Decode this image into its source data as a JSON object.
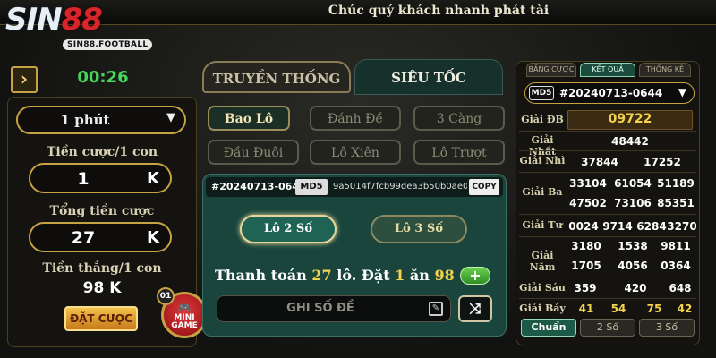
{
  "header": {
    "title": "Chúc quý khách nhanh phát tài"
  },
  "logo": {
    "part1": "SIN",
    "part2": "88",
    "sub": "SIN88.FOOTBALL"
  },
  "left": {
    "back_icon": "chevron-right-icon",
    "timer": "00:26",
    "duration": "1 phút",
    "bet_per_label": "Tiền cược/1 con",
    "bet_per_value": "1",
    "bet_unit": "K",
    "total_label": "Tổng tiền cược",
    "total_value": "27",
    "total_unit": "K",
    "win_label": "Tiền thắng/1 con",
    "win_value": "98 K",
    "bet_button": "ĐẶT CƯỢC",
    "mini_badge": "01",
    "mini_line1": "MINI",
    "mini_line2": "GAME"
  },
  "center": {
    "tabs": [
      "TRUYỀN THỐNG",
      "SIÊU TỐC"
    ],
    "active_tab": "SIÊU TỐC",
    "types": [
      "Bao Lô",
      "Đánh Đề",
      "3 Càng",
      "Đầu Đuôi",
      "Lô Xiên",
      "Lô Trượt"
    ],
    "active_type": "Bao Lô",
    "session": "#20240713-0645",
    "md5_tag": "MD5",
    "hash": "9a5014f7fcb99dea3b50b0ae0",
    "copy": "COPY",
    "lo_options": [
      "Lô 2 Số",
      "Lô 3 Số"
    ],
    "pay_prefix": "Thanh toán",
    "pay_count": "27",
    "pay_mid": "lô. Đặt",
    "pay_one": "1",
    "pay_an": "ăn",
    "pay_win": "98",
    "input_placeholder": "GHI SỐ ĐỀ"
  },
  "right": {
    "tabs": [
      "BẢNG CƯỢC",
      "KẾT QUẢ",
      "THỐNG KÊ"
    ],
    "active_tab": "KẾT QUẢ",
    "md5_tag": "MD5",
    "md5_id": "#20240713-0644",
    "prizes": [
      {
        "label": "Giải ĐB",
        "values": [
          "09722"
        ]
      },
      {
        "label": "Giải Nhất",
        "values": [
          "48442"
        ]
      },
      {
        "label": "Giải Nhì",
        "values": [
          "37844",
          "17252"
        ]
      },
      {
        "label": "Giải Ba",
        "values": [
          "33104",
          "61054",
          "51189",
          "47502",
          "73106",
          "85351"
        ]
      },
      {
        "label": "Giải Tư",
        "values": [
          "0024",
          "9714",
          "6284",
          "3270"
        ]
      },
      {
        "label": "Giải Năm",
        "values": [
          "3180",
          "1538",
          "9811",
          "1705",
          "4056",
          "0364"
        ]
      },
      {
        "label": "Giải Sáu",
        "values": [
          "359",
          "420",
          "648"
        ]
      },
      {
        "label": "Giải Bảy",
        "values": [
          "41",
          "54",
          "75",
          "42"
        ]
      }
    ],
    "filters": [
      "Chuẩn",
      "2 Số",
      "3 Số"
    ],
    "active_filter": "Chuẩn"
  },
  "colors": {
    "gold": "#c7a244",
    "green_active": "#1c5a47",
    "accent_yellow": "#f3d24d",
    "red_logo": "#d9242c"
  }
}
